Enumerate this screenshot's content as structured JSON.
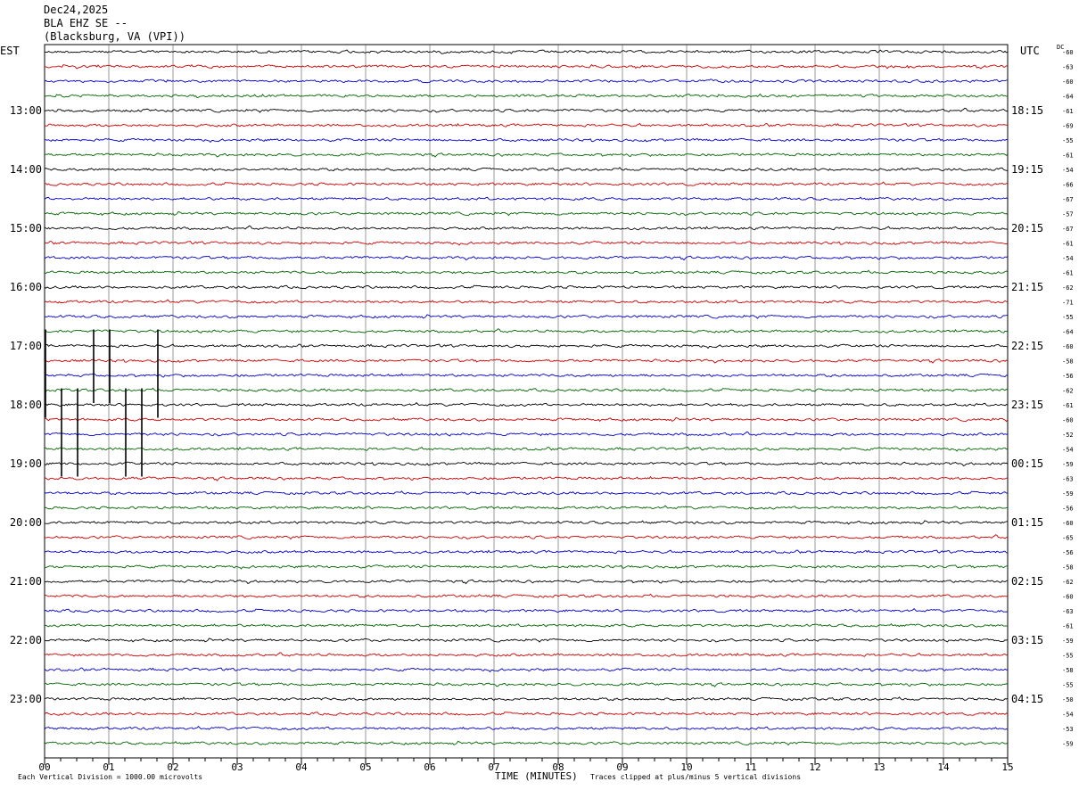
{
  "header": {
    "date": "Dec24,2025",
    "station": "BLA EHZ SE --",
    "location": "(Blacksburg, VA (VPI))"
  },
  "labels": {
    "left_tz": "EST",
    "right_tz": "UTC",
    "dc_header": "DC",
    "xlabel": "TIME (MINUTES)",
    "scale_note": "Each Vertical Division = 1000.00 microvolts",
    "clip_note": "Traces clipped at plus/minus 5 vertical divisions"
  },
  "colors": {
    "trace_cycle": [
      "#000000",
      "#cc0000",
      "#0000cc",
      "#006600"
    ],
    "grid": "#000000"
  },
  "chart_data": {
    "type": "line",
    "subtype": "helicorder",
    "xlim": [
      0,
      15
    ],
    "x_ticks": [
      "00",
      "01",
      "02",
      "03",
      "04",
      "05",
      "06",
      "07",
      "08",
      "09",
      "10",
      "11",
      "12",
      "13",
      "14",
      "15"
    ],
    "rows_per_hour": 4,
    "row_count": 48,
    "est_hour_labels": [
      "13:00",
      "14:00",
      "15:00",
      "16:00",
      "17:00",
      "18:00",
      "19:00",
      "20:00",
      "21:00",
      "22:00",
      "23:00"
    ],
    "utc_hour_labels": [
      "18:15",
      "19:15",
      "20:15",
      "21:15",
      "22:15",
      "23:15",
      "00:15",
      "01:15",
      "02:15",
      "03:15",
      "04:15"
    ],
    "dc_offsets": [
      "-60",
      "-63",
      "-60",
      "-64",
      "-61",
      "-69",
      "-55",
      "-61",
      "-54",
      "-66",
      "-67",
      "-57",
      "-67",
      "-61",
      "-54",
      "-61",
      "-62",
      "-71",
      "-55",
      "-64",
      "-60",
      "-58",
      "-56",
      "-62",
      "-61",
      "-60",
      "-52",
      "-54",
      "-59",
      "-63",
      "-59",
      "-56",
      "-60",
      "-65",
      "-56",
      "-58",
      "-62",
      "-60",
      "-63",
      "-61",
      "-59",
      "-55",
      "-58",
      "-55",
      "-50",
      "-54",
      "-53",
      "-59"
    ],
    "spikes": [
      {
        "row": 19,
        "minute": 0.0,
        "span_rows": 6
      },
      {
        "row": 19,
        "minute": 0.75,
        "span_rows": 5
      },
      {
        "row": 19,
        "minute": 1.0,
        "span_rows": 5
      },
      {
        "row": 19,
        "minute": 1.75,
        "span_rows": 6
      },
      {
        "row": 23,
        "minute": 0.25,
        "span_rows": 6
      },
      {
        "row": 23,
        "minute": 0.5,
        "span_rows": 6
      },
      {
        "row": 23,
        "minute": 1.25,
        "span_rows": 6
      },
      {
        "row": 23,
        "minute": 1.5,
        "span_rows": 6
      }
    ]
  }
}
